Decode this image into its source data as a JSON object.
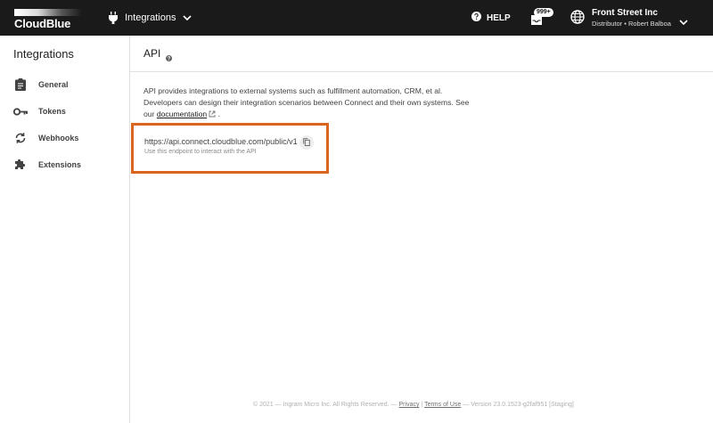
{
  "app": {
    "brand": "CloudBlue"
  },
  "header": {
    "module_label": "Integrations",
    "help_label": "HELP",
    "inbox_badge": "999+",
    "account_name": "Front Street Inc",
    "account_sub": "Distributor • Robert Balboa"
  },
  "sidebar": {
    "title": "Integrations",
    "items": [
      {
        "label": "General",
        "icon": "clipboard-icon"
      },
      {
        "label": "Tokens",
        "icon": "key-icon"
      },
      {
        "label": "Webhooks",
        "icon": "sync-icon"
      },
      {
        "label": "Extensions",
        "icon": "puzzle-icon"
      }
    ]
  },
  "main": {
    "title": "API",
    "desc_line1": "API provides integrations to external systems such as fulfillment automation, CRM, et al.",
    "desc_line2": "Developers can design their integration scenarios between Connect and their own systems. See",
    "desc_our": "our",
    "desc_link": "documentation",
    "desc_end": ".",
    "endpoint_url": "https://api.connect.cloudblue.com/public/v1",
    "endpoint_hint": "Use this endpoint to interact with the API"
  },
  "footer": {
    "copyright": "© 2021 — Ingram Micro Inc. All Rights Reserved. —",
    "privacy": "Privacy",
    "sep": "|",
    "terms": "Terms of Use",
    "version": "— Version 23.0.1523-g2faf951 [Staging]"
  },
  "colors": {
    "topbar": "#1a1a1a",
    "highlight": "#d9651f"
  }
}
